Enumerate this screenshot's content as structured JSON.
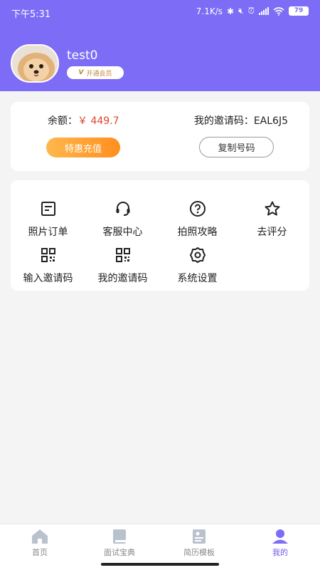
{
  "status": {
    "time": "下午5:31",
    "net_speed": "7.1K/s",
    "battery": "79"
  },
  "profile": {
    "username": "test0",
    "member_label": "开通会员"
  },
  "balance": {
    "label": "余额：",
    "value": "￥ 449.7",
    "invite_label": "我的邀请码：EAL6J5",
    "recharge_button": "特惠充值",
    "copy_button": "复制号码"
  },
  "menu": [
    {
      "label": "照片订单",
      "icon": "order-icon"
    },
    {
      "label": "客服中心",
      "icon": "headset-icon"
    },
    {
      "label": "拍照攻略",
      "icon": "help-icon"
    },
    {
      "label": "去评分",
      "icon": "star-icon"
    },
    {
      "label": "输入邀请码",
      "icon": "qrcode-icon"
    },
    {
      "label": "我的邀请码",
      "icon": "qrcode-icon"
    },
    {
      "label": "系统设置",
      "icon": "gear-icon"
    }
  ],
  "tabs": [
    {
      "label": "首页",
      "icon": "home-icon",
      "active": false
    },
    {
      "label": "面试宝典",
      "icon": "book-icon",
      "active": false
    },
    {
      "label": "简历模板",
      "icon": "resume-icon",
      "active": false
    },
    {
      "label": "我的",
      "icon": "user-icon",
      "active": true
    }
  ],
  "colors": {
    "header": "#7c6cf6",
    "accent": "#6f5bf0",
    "price": "#e0452d",
    "recharge_gradient_start": "#ffb74d",
    "recharge_gradient_end": "#ff8f1f"
  }
}
